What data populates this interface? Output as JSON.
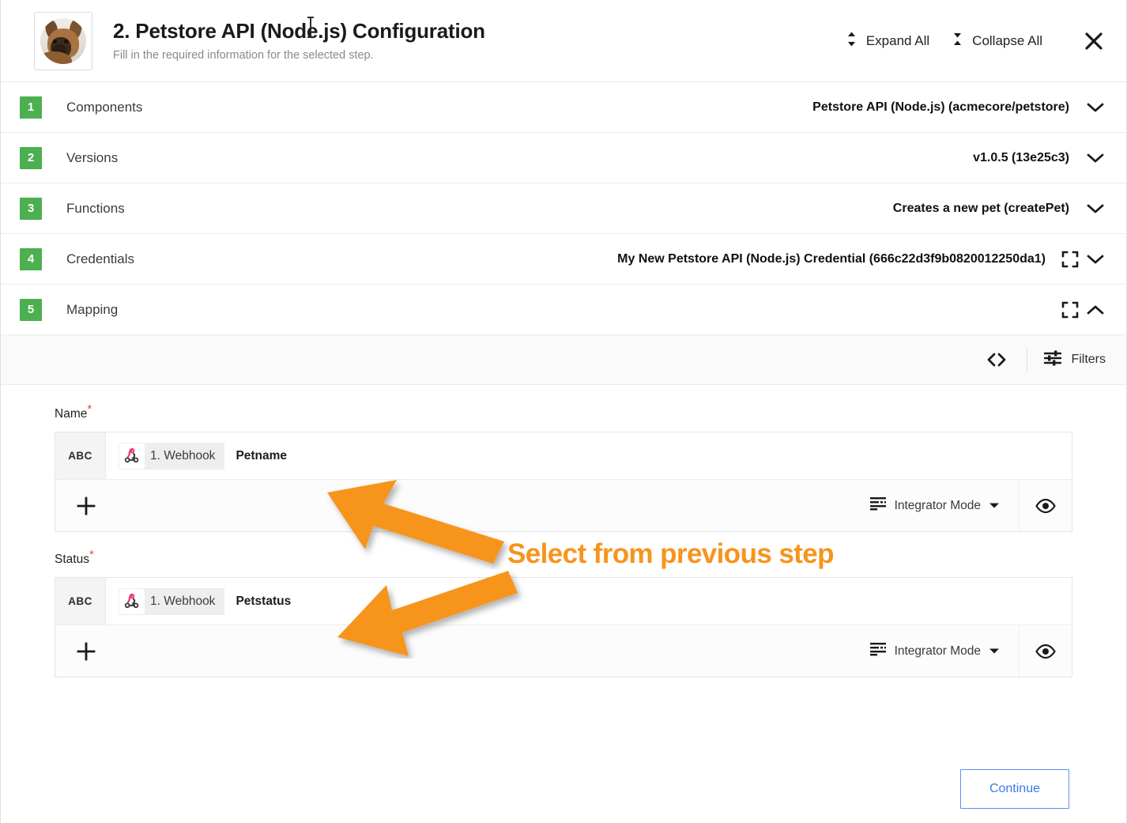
{
  "header": {
    "title": "2. Petstore API (Node.js) Configuration",
    "subtitle": "Fill in the required information for the selected step.",
    "avatar_alt": "dog-avatar",
    "expand_all": "Expand All",
    "collapse_all": "Collapse All",
    "close_label": "×"
  },
  "steps": [
    {
      "number": "1",
      "label": "Components",
      "value": "Petstore API (Node.js) (acmecore/petstore)",
      "has_fullscreen": false,
      "expanded": false
    },
    {
      "number": "2",
      "label": "Versions",
      "value": "v1.0.5 (13e25c3)",
      "has_fullscreen": false,
      "expanded": false
    },
    {
      "number": "3",
      "label": "Functions",
      "value": "Creates a new pet (createPet)",
      "has_fullscreen": false,
      "expanded": false
    },
    {
      "number": "4",
      "label": "Credentials",
      "value": "My New Petstore API (Node.js) Credential (666c22d3f9b0820012250da1)",
      "has_fullscreen": true,
      "expanded": false
    },
    {
      "number": "5",
      "label": "Mapping",
      "value": "",
      "has_fullscreen": true,
      "expanded": true
    }
  ],
  "mapping_toolbar": {
    "code_icon": "code-brackets-icon",
    "filters_label": "Filters",
    "filters_icon": "tune-icon"
  },
  "fields": [
    {
      "label": "Name",
      "required_marker": "*",
      "type_badge": "ABC",
      "chip": {
        "icon": "webhook-icon",
        "source": "1. Webhook",
        "value": "Petname"
      },
      "add_label": "+",
      "mode_label": "Integrator Mode",
      "mode_icon": "short-text-icon",
      "preview_icon": "eye-icon"
    },
    {
      "label": "Status",
      "required_marker": "*",
      "type_badge": "ABC",
      "chip": {
        "icon": "webhook-icon",
        "source": "1. Webhook",
        "value": "Petstatus"
      },
      "add_label": "+",
      "mode_label": "Integrator Mode",
      "mode_icon": "short-text-icon",
      "preview_icon": "eye-icon"
    }
  ],
  "footer": {
    "continue_label": "Continue"
  },
  "annotation": {
    "text": "Select from previous step",
    "color": "#f7941d",
    "arrow_count": 2
  },
  "colors": {
    "step_badge_green": "#4caf50",
    "required_red": "#f0453a",
    "accent_blue": "#3b78e7",
    "annotation_orange": "#f7941d",
    "webhook_pink": "#e8376f"
  }
}
